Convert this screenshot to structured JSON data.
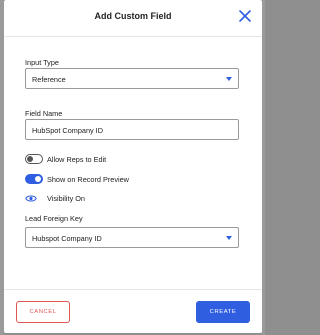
{
  "dialog": {
    "title": "Add Custom Field",
    "fields": {
      "input_type": {
        "label": "Input Type",
        "value": "Reference"
      },
      "field_name": {
        "label": "Field Name",
        "value": "HubSpot Company ID"
      },
      "allow_reps_to_edit": {
        "label": "Allow Reps to Edit",
        "enabled": false
      },
      "show_on_record_preview": {
        "label": "Show on Record Preview",
        "enabled": true
      },
      "visibility": {
        "label": "Visibility On"
      },
      "lead_foreign_key": {
        "label": "Lead Foreign Key",
        "value": "Hubspot Company ID"
      }
    },
    "buttons": {
      "cancel": "CANCEL",
      "create": "CREATE"
    },
    "icons": {
      "close": "close-icon",
      "dropdown": "chevron-down-icon",
      "visibility": "eye-icon"
    },
    "colors": {
      "accent": "#2f5fe0",
      "danger": "#e05656",
      "overlay": "#8f8f8f"
    }
  }
}
